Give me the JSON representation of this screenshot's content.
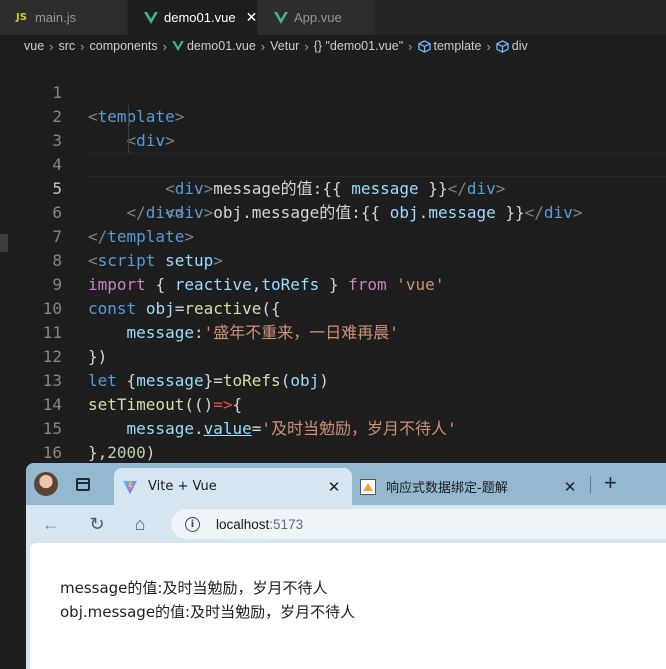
{
  "tabs": [
    {
      "label": "main.js",
      "badge": "JS",
      "active": false
    },
    {
      "label": "demo01.vue",
      "active": true,
      "close": "✕"
    },
    {
      "label": "App.vue",
      "active": false
    }
  ],
  "breadcrumb": [
    "vue",
    "src",
    "components",
    "demo01.vue",
    "Vetur",
    "{} \"demo01.vue\"",
    "template",
    "div"
  ],
  "code": {
    "line_numbers": [
      "1",
      "2",
      "3",
      "4",
      "5",
      "6",
      "7",
      "8",
      "9",
      "10",
      "11",
      "12",
      "13",
      "14",
      "15",
      "16"
    ],
    "current_line": 5,
    "tokens": {
      "template": "template",
      "div": "div",
      "msg_label": "message的值:",
      "open_mustache": "{{ ",
      "close_mustache": " }}",
      "message": "message",
      "obj_msg_label": "obj.message的值:",
      "obj": "obj",
      "dot": ".",
      "script": "script",
      "setup": "setup",
      "import": "import",
      "reactive": "reactive",
      "toRefs": "toRefs",
      "from": "from",
      "vue_str": "'vue'",
      "const": "const",
      "let": "let",
      "setTimeout": "setTimeout",
      "value": "value",
      "str1": "'盛年不重来，一日难再晨'",
      "str2": "'及时当勉励，岁月不待人'",
      "num": "2000"
    }
  },
  "browser": {
    "active_tab": {
      "title": "Vite + Vue",
      "close": "✕"
    },
    "inactive_tab": {
      "title": "响应式数据绑定-题解",
      "close": "✕"
    },
    "new_tab": "+",
    "back": "←",
    "reload": "↻",
    "home": "⌂",
    "info": "i",
    "url_host": "localhost",
    "url_port": ":5173",
    "page_lines": [
      "message的值:及时当勉励，岁月不待人",
      "obj.message的值:及时当勉励，岁月不待人"
    ]
  },
  "colors": {
    "editor_bg": "#1e1e1e",
    "tag": "#569cd6",
    "string": "#ce9178",
    "keyword": "#c586c0",
    "variable": "#9cdcfe",
    "function": "#dcdcaa",
    "number": "#b5cea8"
  },
  "icons": [
    "js-icon",
    "vue-icon",
    "cube-icon",
    "vite-icon",
    "avatar",
    "tab-search-icon",
    "info-icon"
  ]
}
